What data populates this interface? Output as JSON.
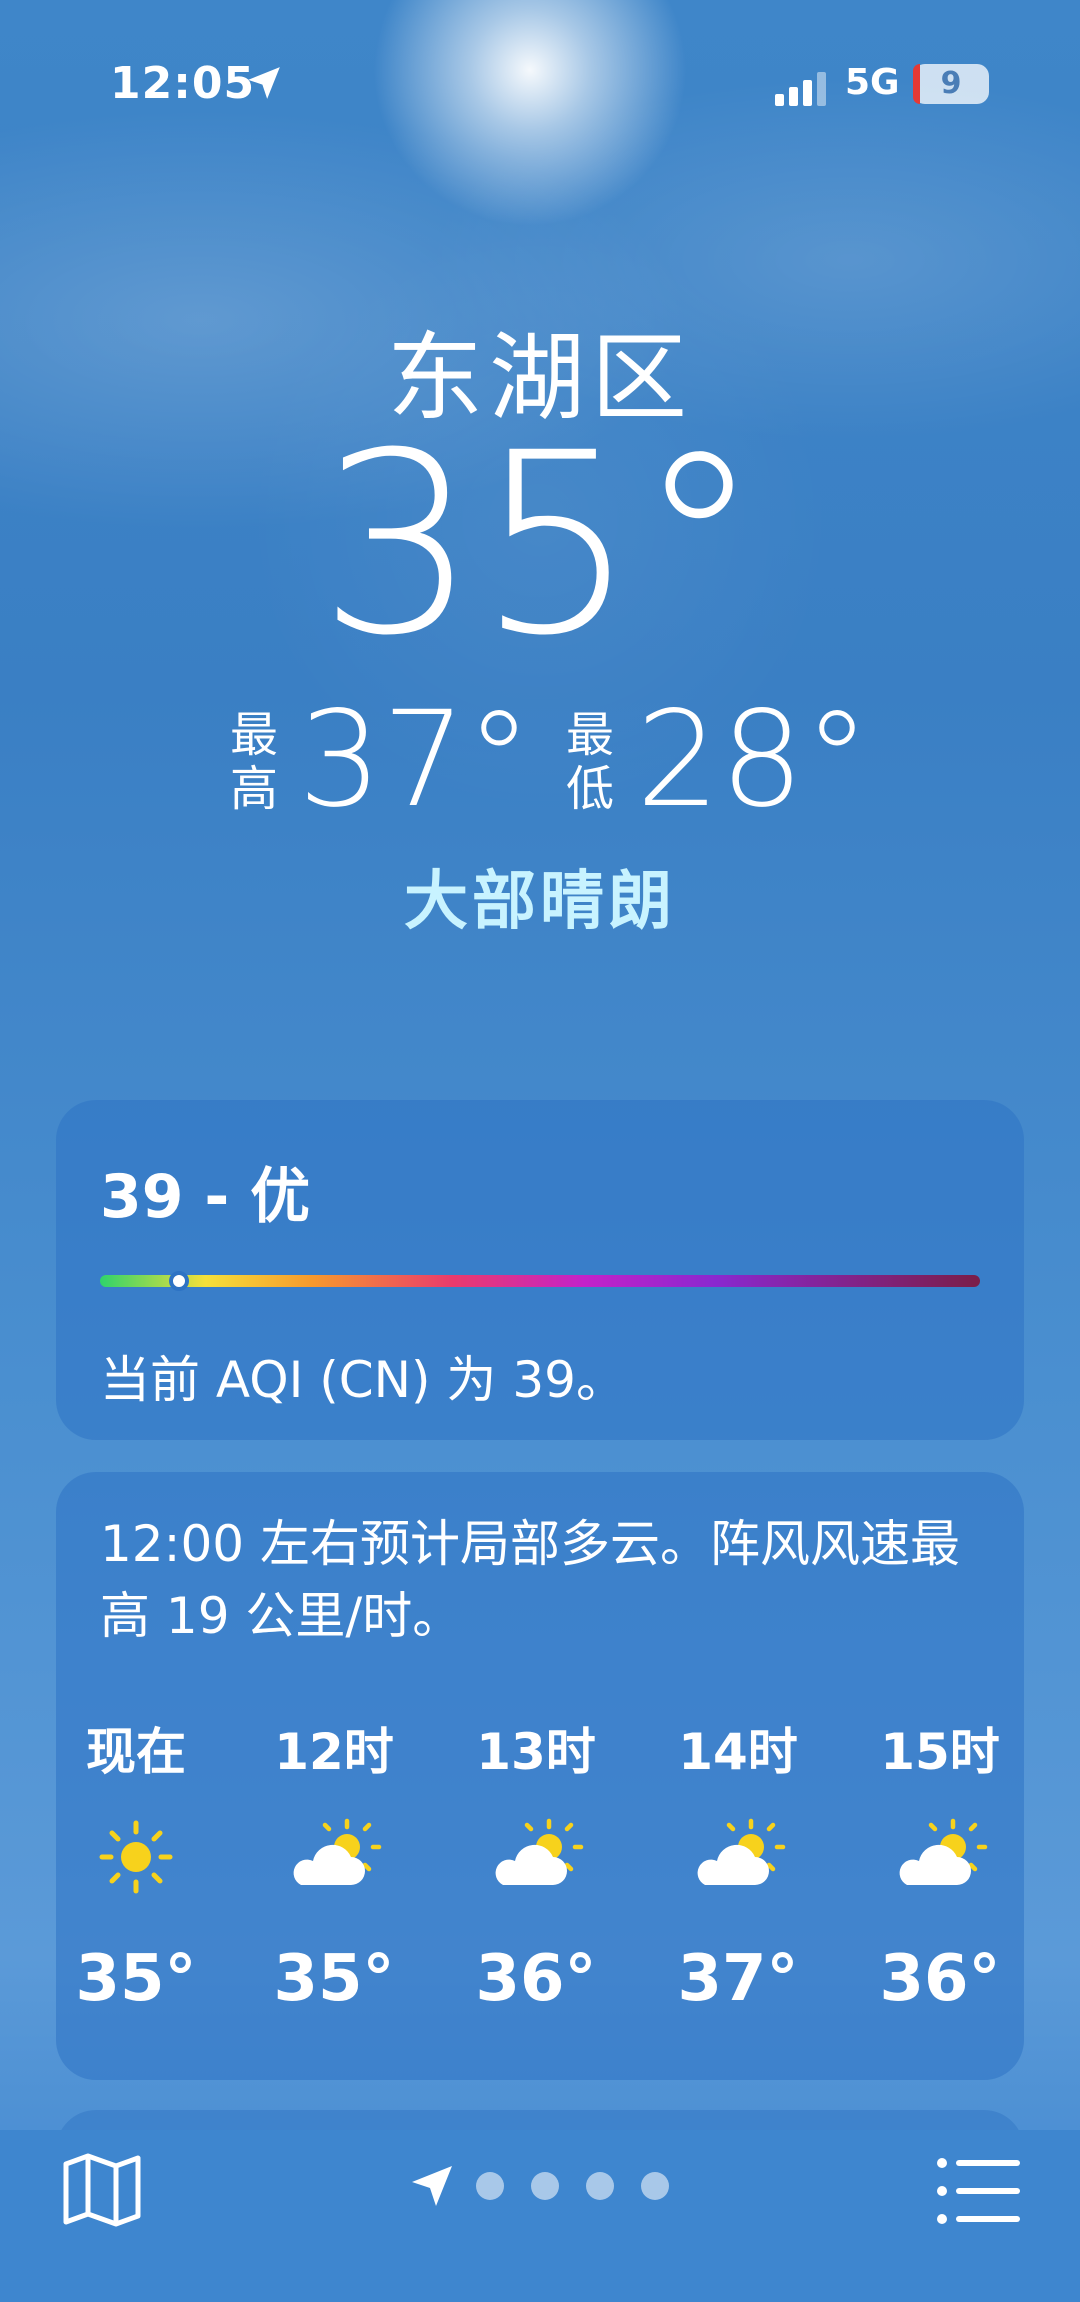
{
  "status_bar": {
    "time": "12:05",
    "network": "5G",
    "battery": "9",
    "battery_level": 0.09
  },
  "location": {
    "city": "东湖区",
    "temperature": "35°",
    "condition": "大部晴朗"
  },
  "high_low": {
    "high_label": "最高",
    "high_value": "37°",
    "low_label": "最低",
    "low_value": "28°"
  },
  "aqi": {
    "title": "39 - 优",
    "description": "当前 AQI (CN) 为 39。",
    "value": 39,
    "scale_position": 0.09
  },
  "forecast": {
    "summary": "12:00 左右预计局部多云。阵风风速最高 19 公里/时。",
    "hours": [
      {
        "label": "现在",
        "icon": "sun-icon",
        "temp": "35°"
      },
      {
        "label": "12时",
        "icon": "partly-cloudy-icon",
        "temp": "35°"
      },
      {
        "label": "13时",
        "icon": "partly-cloudy-icon",
        "temp": "36°"
      },
      {
        "label": "14时",
        "icon": "partly-cloudy-icon",
        "temp": "37°"
      },
      {
        "label": "15时",
        "icon": "partly-cloudy-icon",
        "temp": "36°"
      }
    ]
  },
  "tab_bar": {
    "left_icon": "map-icon",
    "right_icon": "list-icon",
    "page_count": 4,
    "current_location_icon": "location-arrow-icon"
  },
  "colors": {
    "condition_text": "#c8f3ff",
    "sun_yellow": "#f7d21c"
  }
}
